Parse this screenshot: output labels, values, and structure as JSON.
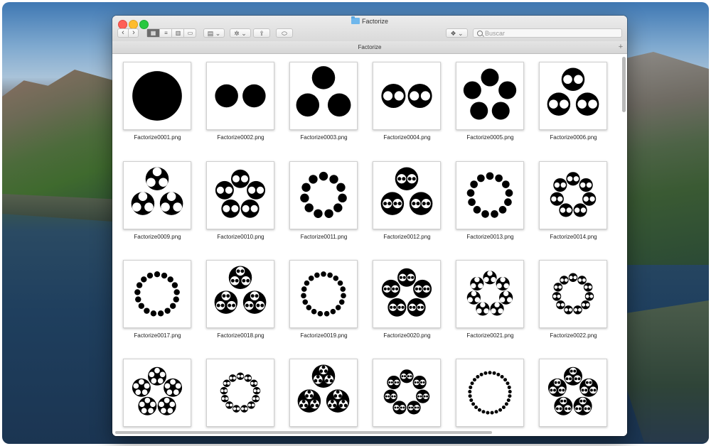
{
  "window": {
    "title": "Factorize",
    "path_title": "Factorize",
    "search_placeholder": "Buscar",
    "add_tab": "+"
  },
  "toolbar": {
    "back": "‹",
    "forward": "›",
    "view_icons": "▦",
    "view_list": "≡",
    "view_columns": "▥",
    "view_gallery": "▭",
    "group": "▤ ⌄",
    "action": "✲ ⌄",
    "share": "⇪",
    "tags": "⬭",
    "dropbox": "❖ ⌄"
  },
  "files": [
    {
      "name": "Factorize0001.png",
      "factors": [
        1
      ]
    },
    {
      "name": "Factorize0002.png",
      "factors": [
        2
      ]
    },
    {
      "name": "Factorize0003.png",
      "factors": [
        3
      ]
    },
    {
      "name": "Factorize0004.png",
      "factors": [
        2,
        2
      ]
    },
    {
      "name": "Factorize0005.png",
      "factors": [
        5
      ]
    },
    {
      "name": "Factorize0006.png",
      "factors": [
        3,
        2
      ]
    },
    {
      "name": "Factorize0009.png",
      "factors": [
        3,
        3
      ]
    },
    {
      "name": "Factorize0010.png",
      "factors": [
        5,
        2
      ]
    },
    {
      "name": "Factorize0011.png",
      "factors": [
        11
      ]
    },
    {
      "name": "Factorize0012.png",
      "factors": [
        3,
        2,
        2
      ]
    },
    {
      "name": "Factorize0013.png",
      "factors": [
        13
      ]
    },
    {
      "name": "Factorize0014.png",
      "factors": [
        7,
        2
      ]
    },
    {
      "name": "Factorize0017.png",
      "factors": [
        17
      ]
    },
    {
      "name": "Factorize0018.png",
      "factors": [
        3,
        3,
        2
      ]
    },
    {
      "name": "Factorize0019.png",
      "factors": [
        19
      ]
    },
    {
      "name": "Factorize0020.png",
      "factors": [
        5,
        2,
        2
      ]
    },
    {
      "name": "Factorize0021.png",
      "factors": [
        7,
        3
      ]
    },
    {
      "name": "Factorize0022.png",
      "factors": [
        11,
        2
      ]
    },
    {
      "name": "",
      "factors": [
        5,
        5
      ]
    },
    {
      "name": "",
      "factors": [
        13,
        2
      ]
    },
    {
      "name": "",
      "factors": [
        3,
        3,
        3
      ]
    },
    {
      "name": "",
      "factors": [
        7,
        2,
        2
      ]
    },
    {
      "name": "",
      "factors": [
        29
      ]
    },
    {
      "name": "",
      "factors": [
        5,
        3,
        2
      ]
    }
  ]
}
